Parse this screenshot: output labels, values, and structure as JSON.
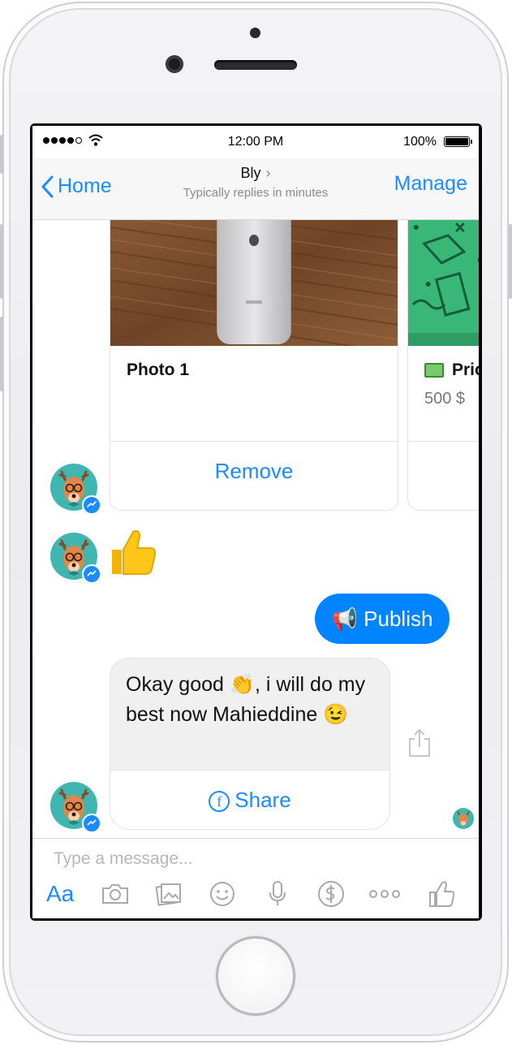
{
  "status_bar": {
    "time": "12:00 PM",
    "battery": "100%"
  },
  "nav": {
    "back_label": "Home",
    "title": "Bly",
    "subtitle": "Typically replies in minutes",
    "manage_label": "Manage"
  },
  "carousel": {
    "cards": [
      {
        "title": "Photo 1",
        "button_label": "Remove"
      },
      {
        "title": "Pric",
        "subtitle": "500 $"
      }
    ]
  },
  "messages": {
    "reaction": "👍",
    "publish_label": "📢 Publish",
    "bot_reply": "Okay good 👏, i will do my best now Mahieddine 😉",
    "share_label": "Share"
  },
  "composer": {
    "placeholder": "Type a message...",
    "aa_label": "Aa"
  },
  "colors": {
    "accent": "#1a8cff",
    "bubble_blue": "#0084ff",
    "avatar_teal": "#3fb6b0"
  }
}
